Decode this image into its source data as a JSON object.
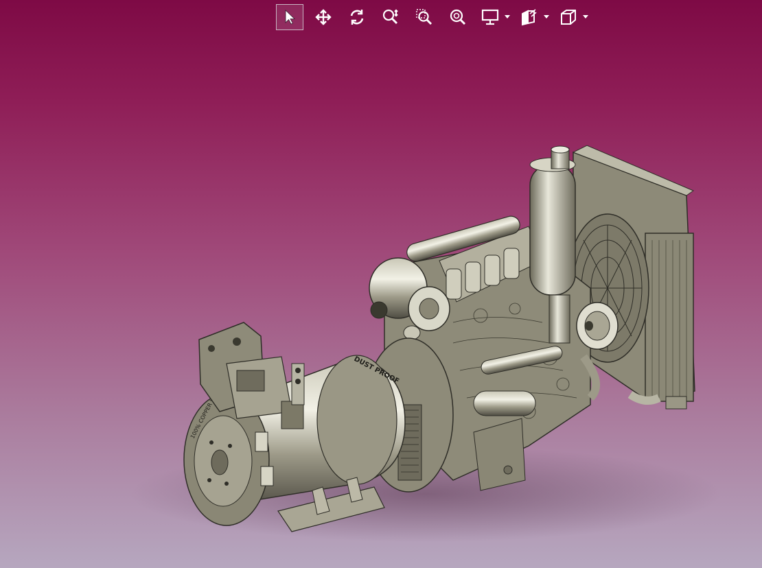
{
  "toolbar": {
    "buttons": [
      {
        "name": "select-tool-button",
        "icon": "pointer-arrow-icon",
        "active": true
      },
      {
        "name": "pan-tool-button",
        "icon": "move-arrows-icon",
        "active": false
      },
      {
        "name": "rotate-tool-button",
        "icon": "rotate-icon",
        "active": false
      },
      {
        "name": "zoom-tool-button",
        "icon": "zoom-icon",
        "active": false
      },
      {
        "name": "zoom-window-button",
        "icon": "zoom-window-icon",
        "active": false
      },
      {
        "name": "zoom-fit-button",
        "icon": "zoom-fit-icon",
        "active": false
      },
      {
        "name": "display-mode-button",
        "icon": "monitor-icon",
        "dropdown": true
      },
      {
        "name": "section-view-button",
        "icon": "section-box-icon",
        "dropdown": true
      },
      {
        "name": "view-orientation-button",
        "icon": "cube-icon",
        "dropdown": true
      }
    ],
    "icon_color": "#ffffff"
  },
  "viewport": {
    "background_top": "#7e0a45",
    "background_bottom": "#b6a7bf",
    "model": {
      "name": "diesel-generator-assembly",
      "body_color": "#8f8c7a",
      "labels": {
        "alternator_band": "100% COPPER WIRE 100% POWER",
        "alternator_ring": "DUST PROOF"
      }
    }
  }
}
